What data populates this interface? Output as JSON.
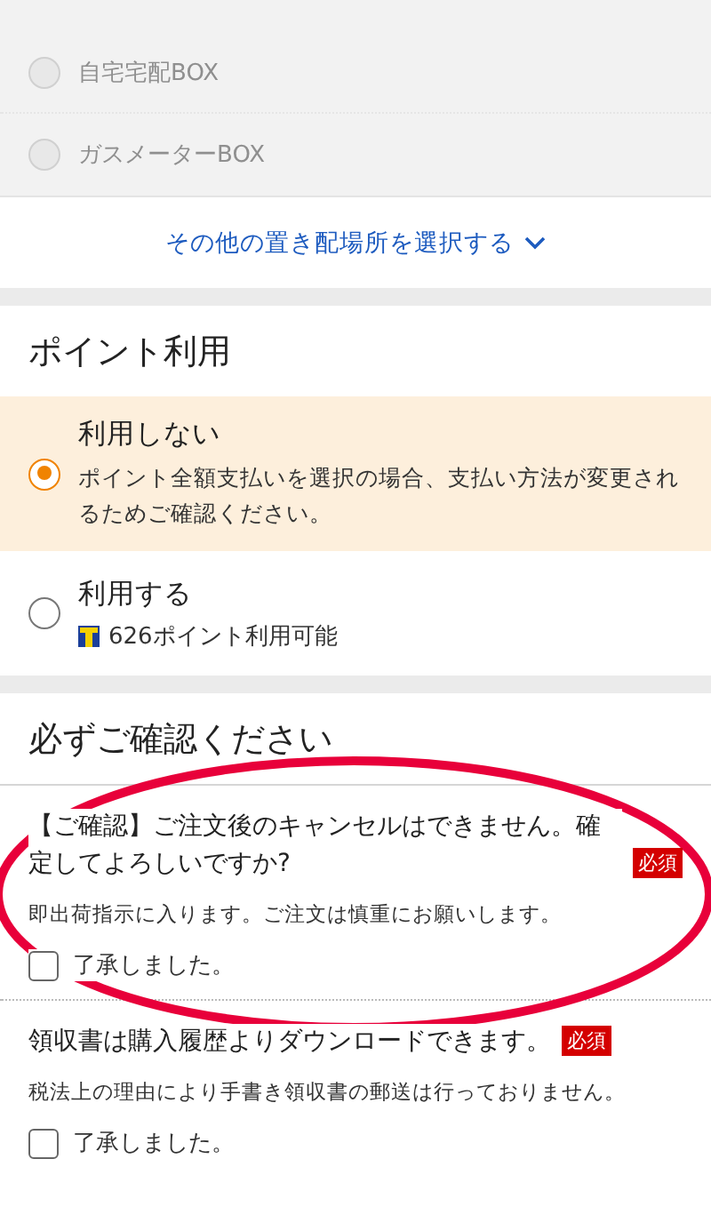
{
  "drop_off_options": [
    {
      "label": "自宅宅配BOX",
      "selected": false,
      "disabled": true
    },
    {
      "label": "ガスメーターBOX",
      "selected": false,
      "disabled": true
    }
  ],
  "more_link": {
    "label": "その他の置き配場所を選択する"
  },
  "points": {
    "title": "ポイント利用",
    "options": [
      {
        "label": "利用しない",
        "note": "ポイント全額支払いを選択の場合、支払い方法が変更されるためご確認ください。",
        "selected": true
      },
      {
        "label": "利用する",
        "balance": "626ポイント利用可能",
        "selected": false
      }
    ]
  },
  "confirm": {
    "title": "必ずご確認ください",
    "items": [
      {
        "text": "【ご確認】ご注文後のキャンセルはできません。確定してよろしいですか?",
        "badge": "必須",
        "note": "即出荷指示に入ります。ご注文は慎重にお願いします。",
        "checkbox_label": "了承しました。",
        "checked": false
      },
      {
        "text": "領収書は購入履歴よりダウンロードできます。",
        "badge": "必須",
        "note": "税法上の理由により手書き領収書の郵送は行っておりません。",
        "checkbox_label": "了承しました。",
        "checked": false
      }
    ]
  }
}
